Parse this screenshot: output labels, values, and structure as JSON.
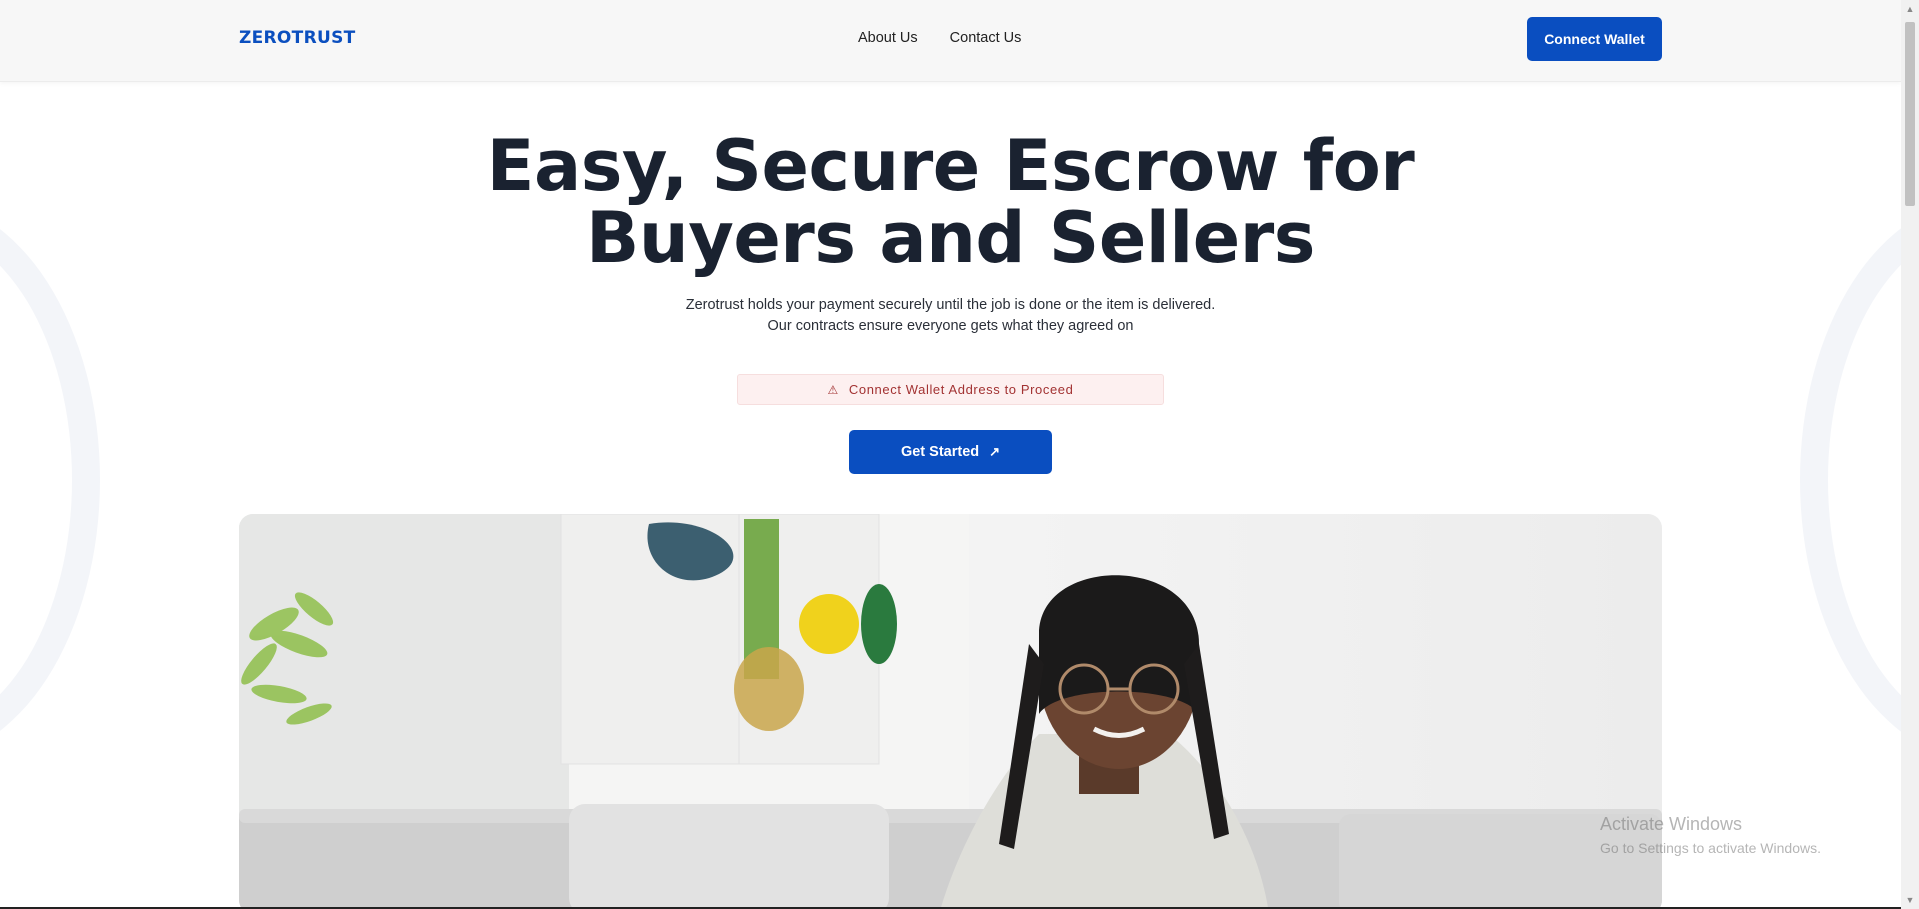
{
  "navbar": {
    "logo": "ZEROTRUST",
    "links": [
      "About Us",
      "Contact Us"
    ],
    "connect_label": "Connect Wallet"
  },
  "hero": {
    "title_line1": "Easy, Secure Escrow for",
    "title_line2": "Buyers and Sellers",
    "subtitle_line1": "Zerotrust holds your payment securely until the job is done or the item is delivered.",
    "subtitle_line2": "Our contracts ensure everyone gets what they agreed on",
    "alert_text": "Connect Wallet Address to Proceed",
    "alert_icon": "warning-icon",
    "cta_label": "Get Started",
    "cta_icon": "arrow-up-right-icon"
  },
  "watermark": {
    "title": "Activate Windows",
    "subtitle": "Go to Settings to activate Windows."
  },
  "colors": {
    "brand": "#0a4ec0",
    "heading": "#1a2230",
    "alert_bg": "#fdf0f0",
    "alert_text": "#a23232"
  }
}
